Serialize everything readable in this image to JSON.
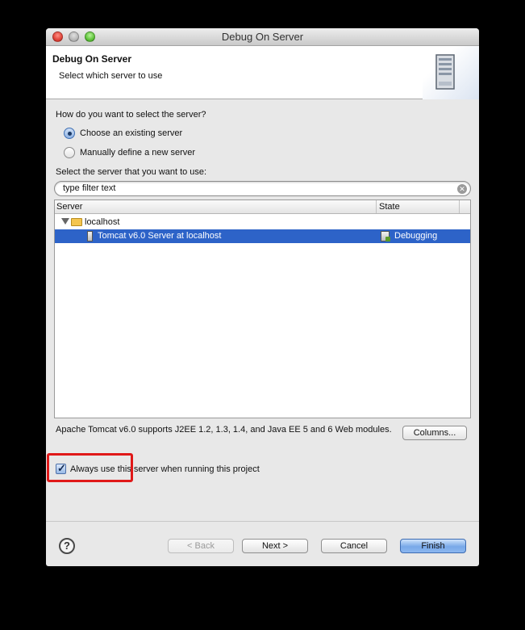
{
  "window": {
    "title": "Debug On Server"
  },
  "header": {
    "title": "Debug On Server",
    "subtitle": "Select which server to use",
    "icon": "server-icon"
  },
  "selection": {
    "question": "How do you want to select the server?",
    "options": [
      {
        "label": "Choose an existing server",
        "selected": true
      },
      {
        "label": "Manually define a new server",
        "selected": false
      }
    ],
    "list_label": "Select the server that you want to use:"
  },
  "filter": {
    "value": "type filter text"
  },
  "table": {
    "columns": [
      "Server",
      "State"
    ],
    "rows": [
      {
        "name": "localhost",
        "state": "",
        "expanded": true
      },
      {
        "name": "Tomcat v6.0 Server at localhost",
        "state": "Debugging",
        "selected": true
      }
    ]
  },
  "description": "Apache Tomcat v6.0 supports J2EE 1.2, 1.3, 1.4, and Java EE 5 and 6 Web modules.",
  "columns_button": "Columns...",
  "always_use": {
    "label": "Always use this server when running this project",
    "checked": true
  },
  "footer": {
    "help": "?",
    "back": "< Back",
    "next": "Next >",
    "cancel": "Cancel",
    "finish": "Finish"
  },
  "colors": {
    "selection": "#2d63c8",
    "highlight_box": "#e01919",
    "default_button": "#78a8e8"
  }
}
